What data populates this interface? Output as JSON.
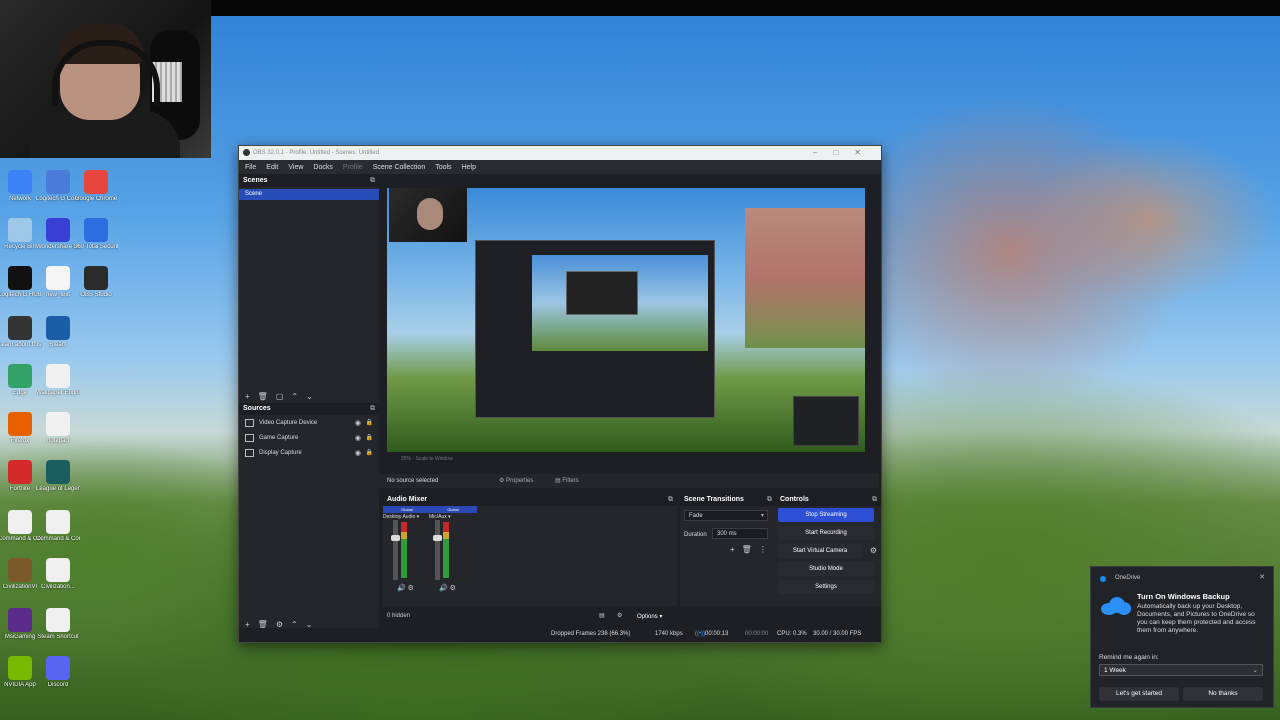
{
  "desktop": {
    "icons": [
      {
        "label": "Network",
        "color": "#3b82f6"
      },
      {
        "label": "Logitech G Connect",
        "color": "#4b7bd9"
      },
      {
        "label": "Google Chrome",
        "color": "#e8453c"
      },
      {
        "label": "Recycle Bin",
        "color": "#9ec6e6"
      },
      {
        "label": "Wondershare Uniconverter",
        "color": "#3a3fd6"
      },
      {
        "label": "360 Total Security",
        "color": "#2e6de0"
      },
      {
        "label": "Logitech G HUB",
        "color": "#111111"
      },
      {
        "label": "new_text",
        "color": "#f5f5f5"
      },
      {
        "label": "OBS Studio",
        "color": "#2b2b2b"
      },
      {
        "label": "Learn about this picture",
        "color": "#333333"
      },
      {
        "label": "Steam",
        "color": "#1b5ea8"
      },
      {
        "label": "Edge",
        "color": "#33a36a"
      },
      {
        "label": "Wallpaper Engine",
        "color": "#f0f0f0"
      },
      {
        "label": "Firefox",
        "color": "#e66000"
      },
      {
        "label": "notepad",
        "color": "#f0f0f0"
      },
      {
        "label": "Fortnite",
        "color": "#d42a2a"
      },
      {
        "label": "League of Legends",
        "color": "#1a5e60"
      },
      {
        "label": "Command & Conquer",
        "color": "#f0f0f0"
      },
      {
        "label": "Command & Conquer",
        "color": "#f0f0f0"
      },
      {
        "label": "CivilizationVI",
        "color": "#7a5a2a"
      },
      {
        "label": "Civilization...",
        "color": "#f0f0f0"
      },
      {
        "label": "MsiGaming",
        "color": "#5b2b8c"
      },
      {
        "label": "Steam Shortcut",
        "color": "#f0f0f0"
      },
      {
        "label": "NVIDIA App",
        "color": "#76b900"
      },
      {
        "label": "Discord",
        "color": "#5865f2"
      }
    ]
  },
  "obs": {
    "title": "OBS 32.0.1 - Profile: Untitled - Scenes: Untitled",
    "menu": [
      "File",
      "Edit",
      "View",
      "Docks",
      "Profile",
      "Scene Collection",
      "Tools",
      "Help"
    ],
    "scenes": {
      "header": "Scenes",
      "items": [
        "Scene"
      ]
    },
    "sources": {
      "header": "Sources",
      "items": [
        "Video Capture Device",
        "Game Capture",
        "Display Capture"
      ]
    },
    "preview_bar": "25% · Scale to Window",
    "properties_bar": {
      "no_source": "No source selected",
      "properties": "Properties",
      "filters": "Filters"
    },
    "audio_mixer": {
      "header": "Audio Mixer",
      "channels": [
        {
          "badge": "Global",
          "name": "Desktop Audio",
          "level": 0.72
        },
        {
          "badge": "Global",
          "name": "Mic/Aux",
          "level": 0.72
        }
      ]
    },
    "scene_transitions": {
      "header": "Scene Transitions",
      "transition": "Fade",
      "duration_label": "Duration",
      "duration": "300 ms"
    },
    "controls": {
      "header": "Controls",
      "buttons": [
        "Stop Streaming",
        "Start Recording",
        "Start Virtual Camera",
        "Studio Mode",
        "Settings"
      ]
    },
    "bottom": {
      "hidden": "0 hidden",
      "options": "Options"
    },
    "status": {
      "dropped": "Dropped Frames 238 (66.3%)",
      "bitrate": "1740 kbps",
      "stream_time": "00:00:13",
      "rec_time": "00:00:00",
      "cpu": "CPU: 0.3%",
      "fps": "30.00 / 30.00 FPS"
    }
  },
  "notification": {
    "app": "OneDrive",
    "title": "Turn On Windows Backup",
    "body": "Automatically back up your Desktop, Documents, and Pictures to OneDrive so you can keep them protected and access them from anywhere.",
    "remind_label": "Remind me again in:",
    "remind_value": "1 Week",
    "primary": "Let's get started",
    "secondary": "No thanks"
  }
}
